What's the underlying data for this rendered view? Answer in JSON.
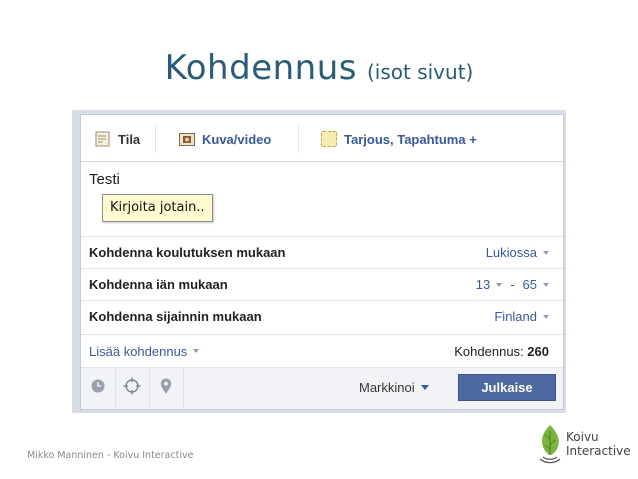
{
  "slide": {
    "title": "Kohdennus",
    "subtitle": "(isot sivut)",
    "footer": "Mikko Manninen - Koivu Interactive",
    "logo_line1": "Koivu",
    "logo_line2": "Interactive"
  },
  "composer": {
    "tabs": [
      {
        "label": "Tila",
        "icon": "status-icon"
      },
      {
        "label": "Kuva/video",
        "icon": "photo-icon"
      },
      {
        "label": "Tarjous, Tapahtuma +",
        "icon": "offer-icon"
      }
    ],
    "status_text": "Testi",
    "tooltip": "Kirjoita jotain..",
    "targeting": [
      {
        "label": "Kohdenna koulutuksen mukaan",
        "value": "Lukiossa"
      },
      {
        "label": "Kohdenna iän mukaan",
        "age_min": "13",
        "age_max": "65",
        "separator": "-"
      },
      {
        "label": "Kohdenna sijainnin mukaan",
        "value": "Finland"
      }
    ],
    "add_targeting": "Lisää kohdennus",
    "reach_label": "Kohdennus:",
    "reach_value": "260",
    "bottom_icons": [
      "clock-icon",
      "target-icon",
      "location-pin-icon"
    ],
    "audience_selector": "Markkinoi",
    "publish_label": "Julkaise"
  },
  "colors": {
    "title": "#2a5c77",
    "link": "#3b5998",
    "publish_button": "#4e69a2",
    "tooltip_bg": "#fffbd0"
  }
}
